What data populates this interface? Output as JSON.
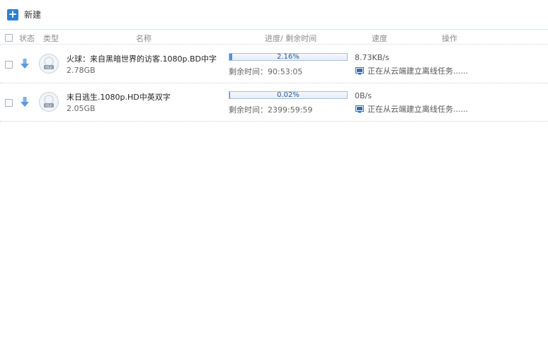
{
  "toolbar": {
    "new_label": "新建"
  },
  "header": {
    "status": "状态",
    "type": "类型",
    "name": "名称",
    "progress": "进度/ 剩余时间",
    "speed": "速度",
    "action": "操作"
  },
  "tasks": [
    {
      "name": "火球：来自黑暗世界的访客.1080p.BD中字",
      "size": "2.78GB",
      "progress_text": "2.16%",
      "progress": 0.0216,
      "remaining": "剩余时间：90:53:05",
      "speed": "8.73KB/s",
      "status": "正在从云端建立离线任务......"
    },
    {
      "name": "末日逃生.1080p.HD中英双字",
      "size": "2.05GB",
      "progress_text": "0.02%",
      "progress": 0.0002,
      "remaining": "剩余时间：2399:59:59",
      "speed": "0B/s",
      "status": "正在从云端建立离线任务......"
    }
  ],
  "colors": {
    "accent": "#2f7fd3",
    "progress_fill": "#4f8fd6",
    "progress_border": "#a7c0dc"
  }
}
